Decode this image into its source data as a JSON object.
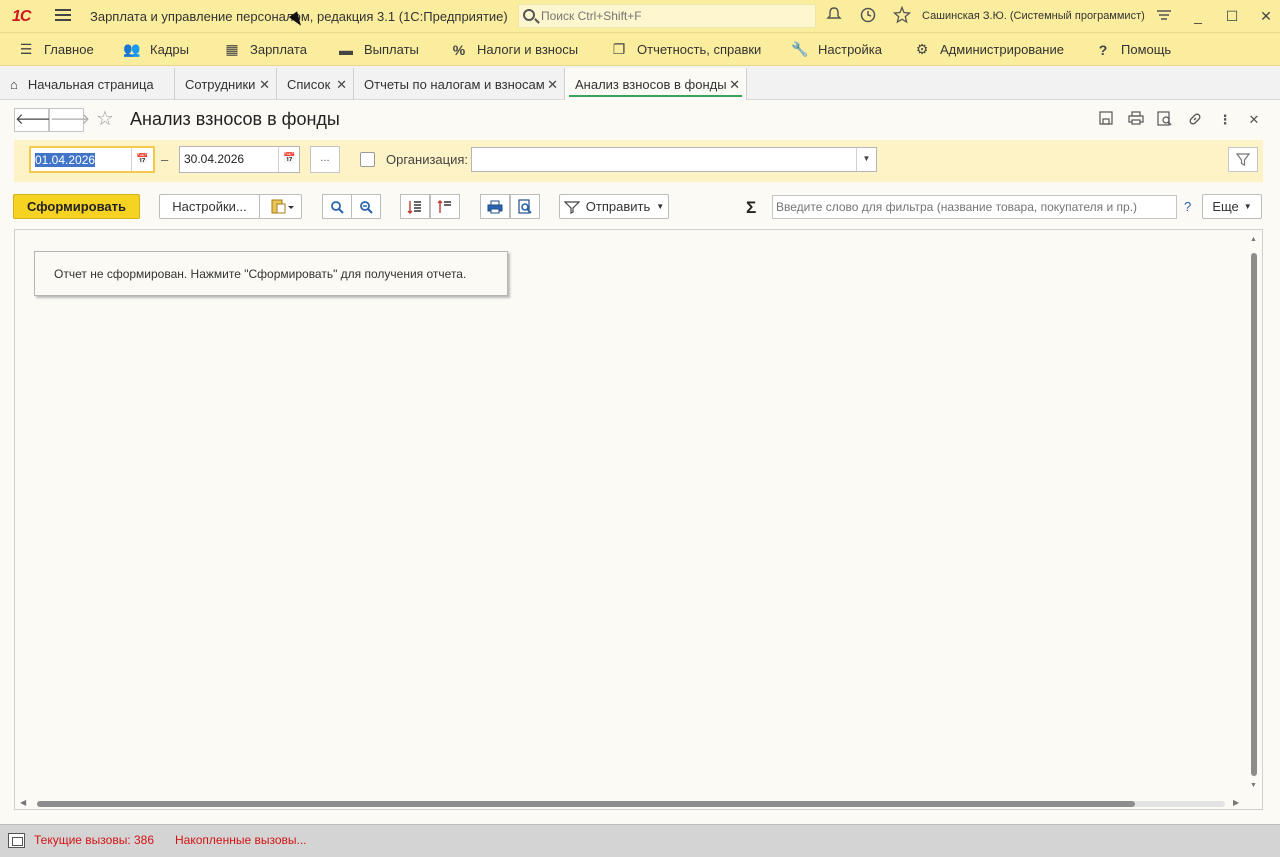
{
  "titlebar": {
    "logo": "1С",
    "title": "Зарплата и управление персоналом, редакция 3.1  (1С:Предприятие)",
    "search_placeholder": "Поиск Ctrl+Shift+F",
    "user": "Сашинская З.Ю. (Системный программист)"
  },
  "mainmenu": {
    "items": [
      {
        "label": "Главное",
        "icon": "menu-lines-icon"
      },
      {
        "label": "Кадры",
        "icon": "people-icon"
      },
      {
        "label": "Зарплата",
        "icon": "calculator-icon"
      },
      {
        "label": "Выплаты",
        "icon": "wallet-icon"
      },
      {
        "label": "Налоги и взносы",
        "icon": "percent-icon"
      },
      {
        "label": "Отчетность, справки",
        "icon": "documents-icon"
      },
      {
        "label": "Настройка",
        "icon": "wrench-icon"
      },
      {
        "label": "Администрирование",
        "icon": "gear-icon"
      },
      {
        "label": "Помощь",
        "icon": "question-icon"
      }
    ]
  },
  "tabs": [
    {
      "label": "Начальная страница"
    },
    {
      "label": "Сотрудники"
    },
    {
      "label": "Список"
    },
    {
      "label": "Отчеты по налогам и взносам"
    },
    {
      "label": "Анализ взносов в фонды",
      "active": true
    }
  ],
  "form": {
    "title": "Анализ взносов в фонды",
    "date_from": "01.04.2026",
    "date_to": "30.04.2026",
    "period_dash": "–",
    "dots_label": "...",
    "org_label": "Организация:",
    "org_value": ""
  },
  "toolbar": {
    "generate": "Сформировать",
    "settings": "Настройки...",
    "send": "Отправить",
    "sigma": "Σ",
    "filter_placeholder": "Введите слово для фильтра (название товара, покупателя и пр.)",
    "help": "?",
    "more": "Еще"
  },
  "report": {
    "message": "Отчет не сформирован. Нажмите \"Сформировать\" для получения отчета."
  },
  "statusbar": {
    "current_calls": "Текущие вызовы: 386",
    "accumulated_calls": "Накопленные вызовы..."
  },
  "colors": {
    "accent_yellow": "#fbed9e",
    "primary_button": "#f6d323",
    "active_tab_underline": "#3aa35b",
    "status_text": "#d21414"
  }
}
